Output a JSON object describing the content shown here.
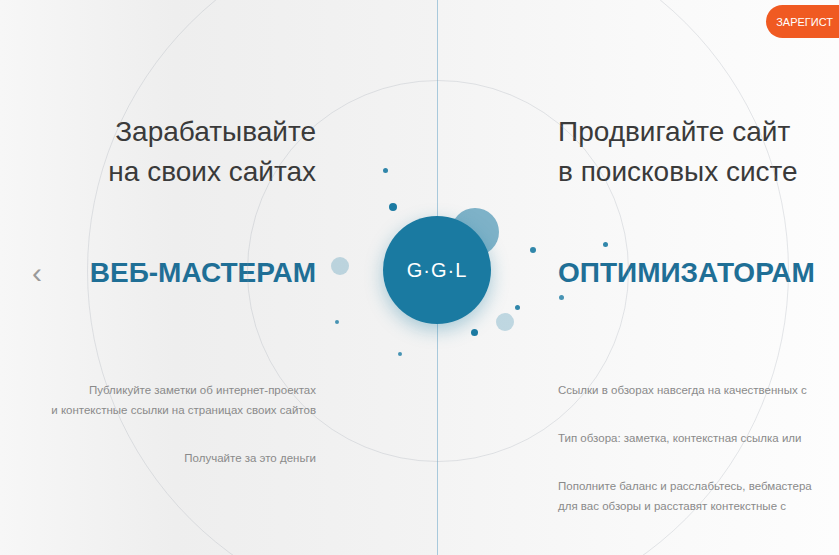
{
  "header": {
    "register_button": "ЗАРЕГИСТ"
  },
  "logo": "G·G·L",
  "navigation": {
    "prev_arrow": "‹"
  },
  "columns": [
    {
      "kind": "left",
      "heading": [
        "Зарабатывайте",
        "на своих сайтах"
      ],
      "title": "ВЕБ-МАСТЕРАМ",
      "paragraphs": [
        [
          "Публикуйте заметки об интернет-проектах",
          "и контекстные ссылки на страницах своих сайтов"
        ],
        [
          "Получайте за это деньги"
        ]
      ]
    },
    {
      "kind": "right",
      "heading": [
        "Продвигайте сайт",
        "в поисковых систе"
      ],
      "title": "ОПТИМИЗАТОРАМ",
      "paragraphs": [
        [
          "Ссылки в обзорах навсегда на качественных с"
        ],
        [
          "Тип обзора: заметка, контекстная ссылка или"
        ],
        [
          "Пополните баланс и расслабьтесь, вебмастера",
          "для вас обзоры и расставят контекстные с"
        ]
      ]
    }
  ]
}
